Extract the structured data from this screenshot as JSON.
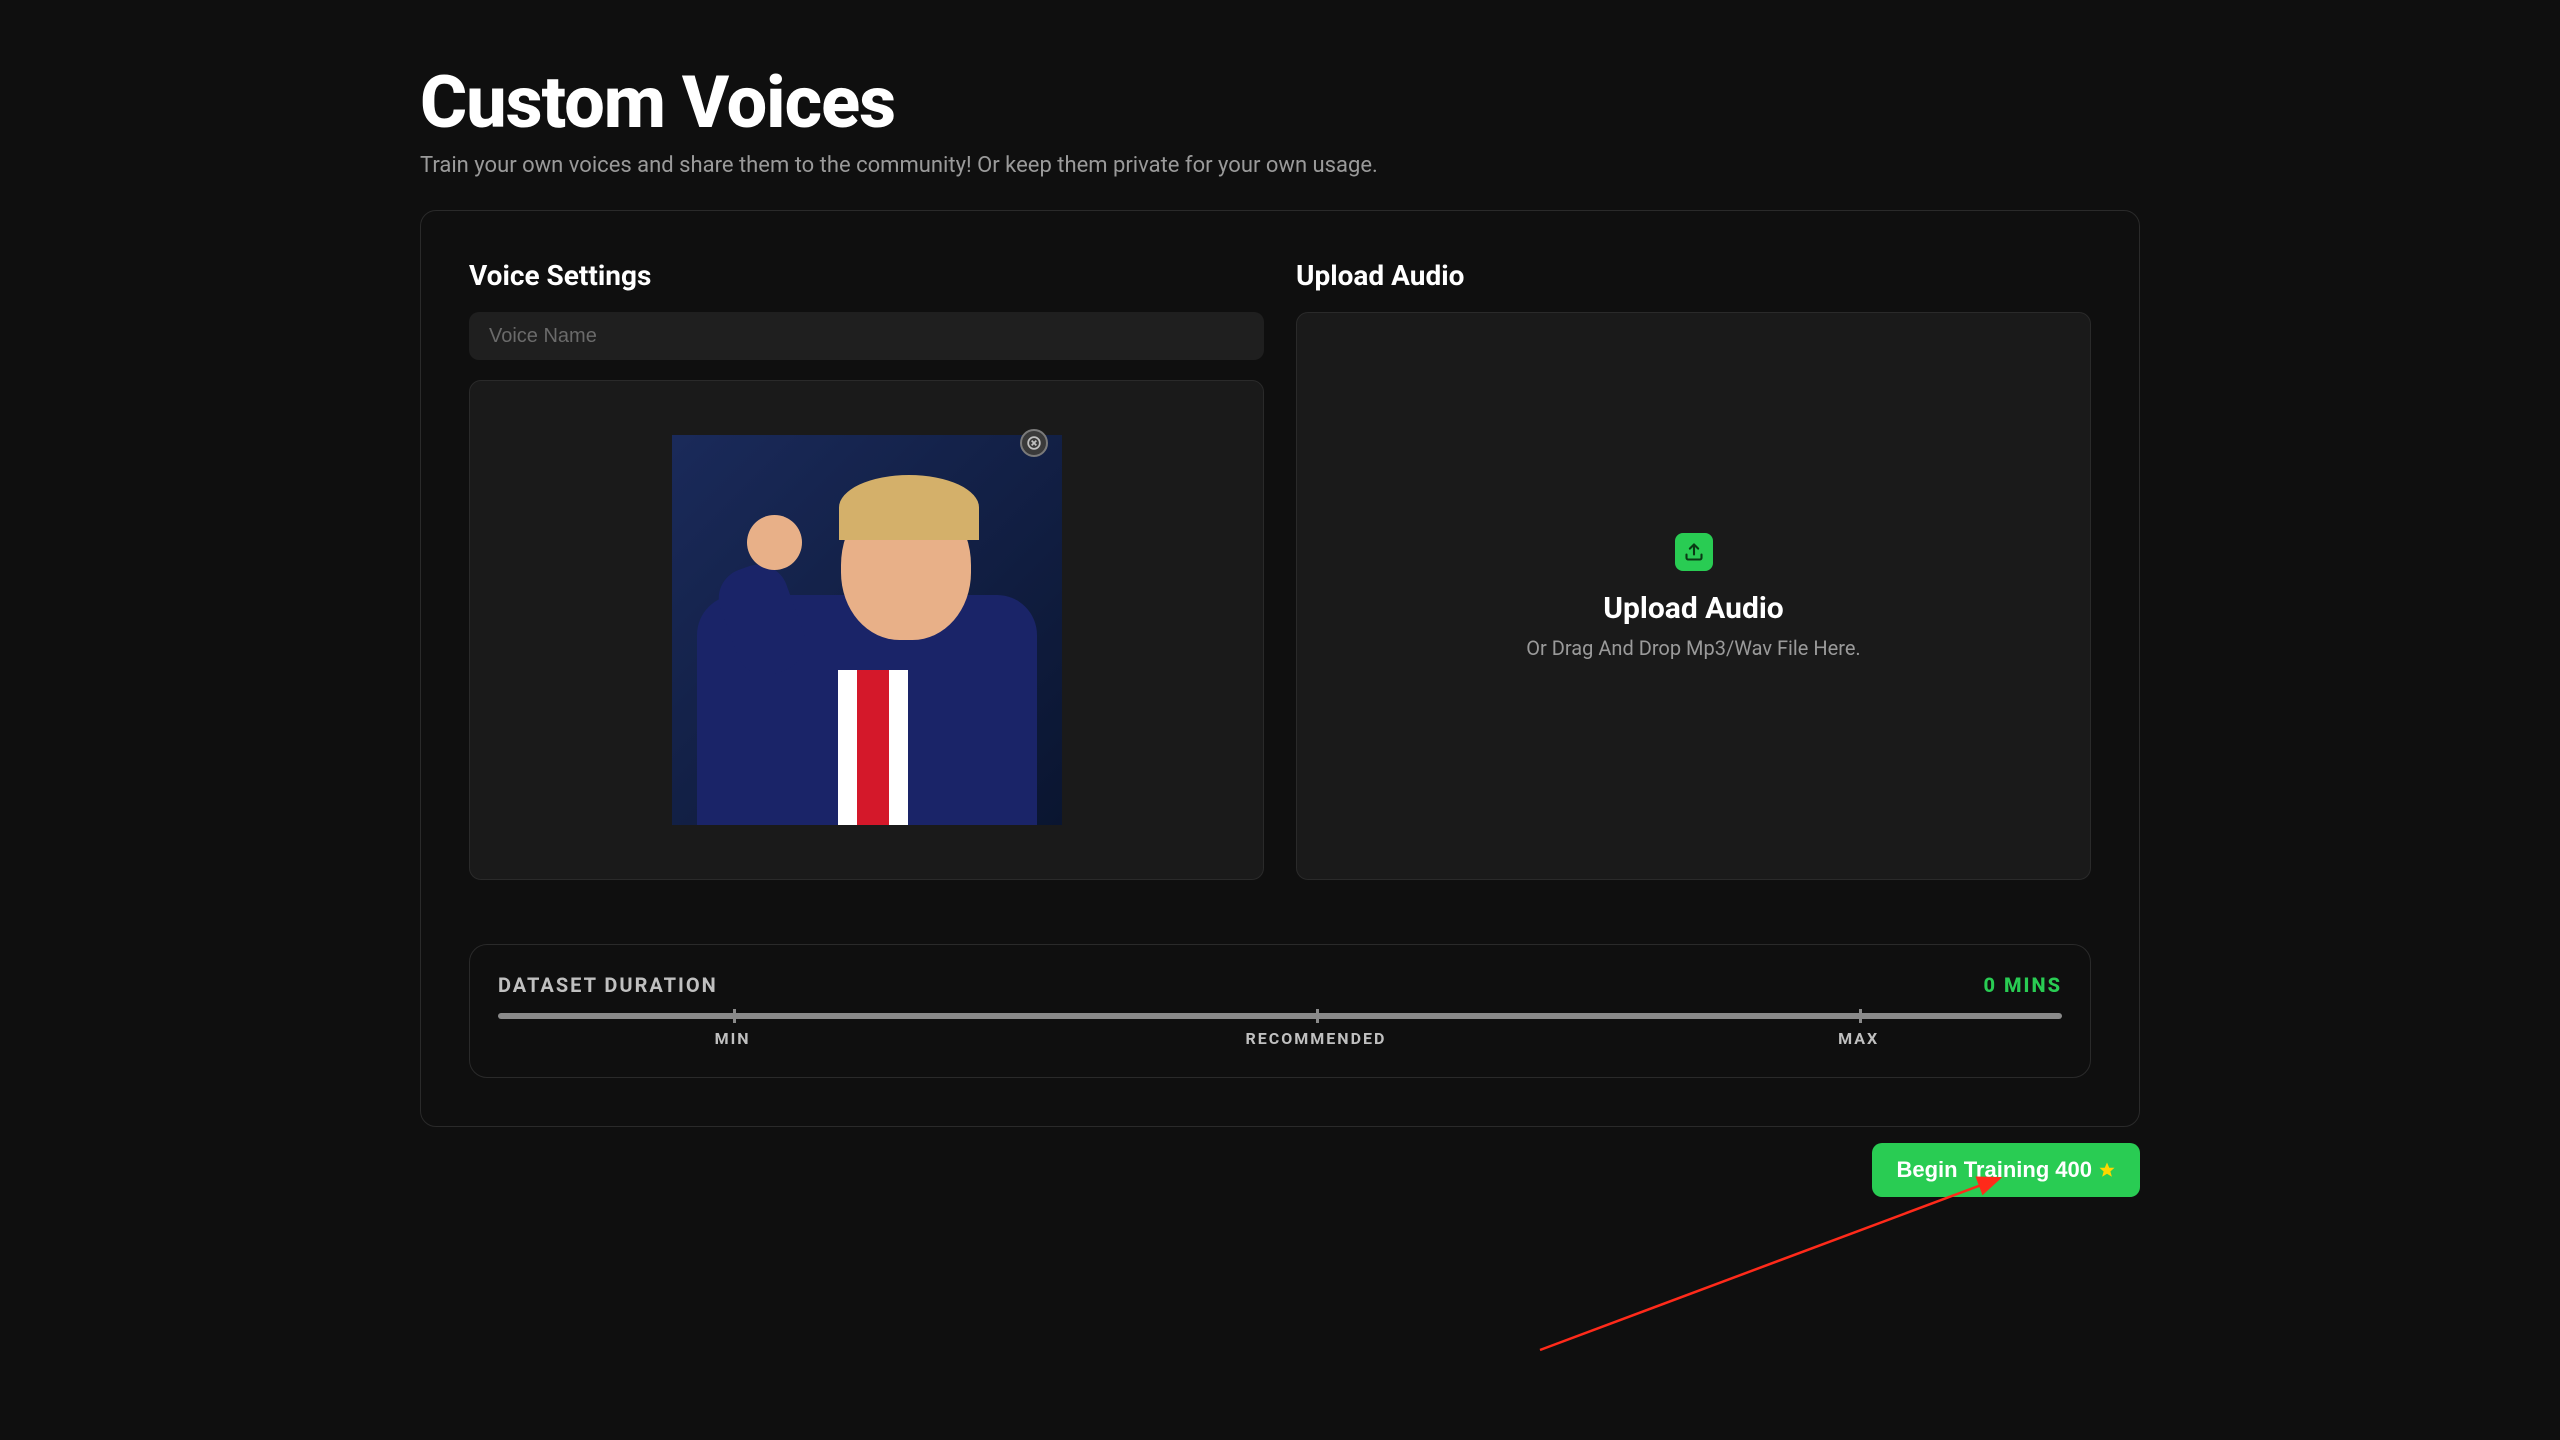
{
  "page": {
    "title": "Custom Voices",
    "subtitle": "Train your own voices and share them to the community! Or keep them private for your own usage."
  },
  "voiceSettings": {
    "title": "Voice Settings",
    "nameInput": {
      "value": "",
      "placeholder": "Voice Name"
    }
  },
  "uploadAudio": {
    "sectionTitle": "Upload Audio",
    "dropTitle": "Upload Audio",
    "dropSubtitle": "Or Drag And Drop Mp3/Wav File Here."
  },
  "datasetDuration": {
    "label": "DATASET DURATION",
    "value": "0 MINS",
    "markers": {
      "min": "MIN",
      "recommended": "RECOMMENDED",
      "max": "MAX"
    }
  },
  "trainButton": {
    "labelPrefix": "Begin Training ",
    "cost": "400"
  }
}
